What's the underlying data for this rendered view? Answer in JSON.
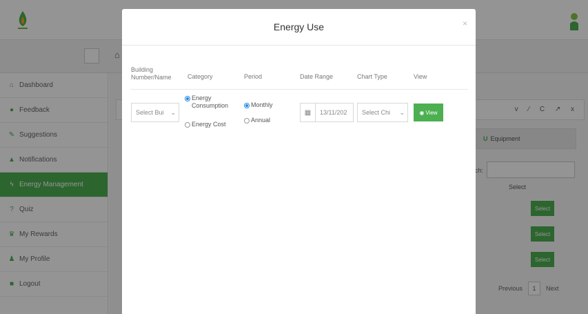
{
  "sidebar": {
    "items": [
      {
        "label": "Dashboard",
        "icon": "home-icon"
      },
      {
        "label": "Feedback",
        "icon": "chat-icon"
      },
      {
        "label": "Suggestions",
        "icon": "suggestion-icon"
      },
      {
        "label": "Notifications",
        "icon": "bell-icon"
      },
      {
        "label": "Energy Management",
        "icon": "bolt-icon"
      },
      {
        "label": "Quiz",
        "icon": "question-icon"
      },
      {
        "label": "My Rewards",
        "icon": "trophy-icon"
      },
      {
        "label": "My Profile",
        "icon": "user-icon"
      },
      {
        "label": "Logout",
        "icon": "lock-icon"
      }
    ],
    "active_index": 4
  },
  "background": {
    "panel_tools": "v ⁄ C ↗ x",
    "equipment_tab": "Equipment",
    "search_label": "rch:",
    "column_header": "Select",
    "select_label": "Select",
    "pager": {
      "prev": "Previous",
      "page": "1",
      "next": "Next"
    }
  },
  "modal": {
    "title": "Energy Use",
    "close": "×",
    "headers": {
      "building": "Building Number/Name",
      "category": "Category",
      "period": "Period",
      "date_range": "Date Range",
      "chart_type": "Chart Type",
      "view": "View"
    },
    "building_select": "Select Bui",
    "category_options": [
      {
        "label": "Energy Consumption",
        "checked": true
      },
      {
        "label": "Energy Cost",
        "checked": false
      }
    ],
    "period_options": [
      {
        "label": "Monthly",
        "checked": true
      },
      {
        "label": "Annual",
        "checked": false
      }
    ],
    "date_value": "13/11/202",
    "chart_type_select": "Select Chi",
    "view_button": "View"
  },
  "colors": {
    "accent": "#4caf50",
    "radio": "#1e88e5"
  }
}
